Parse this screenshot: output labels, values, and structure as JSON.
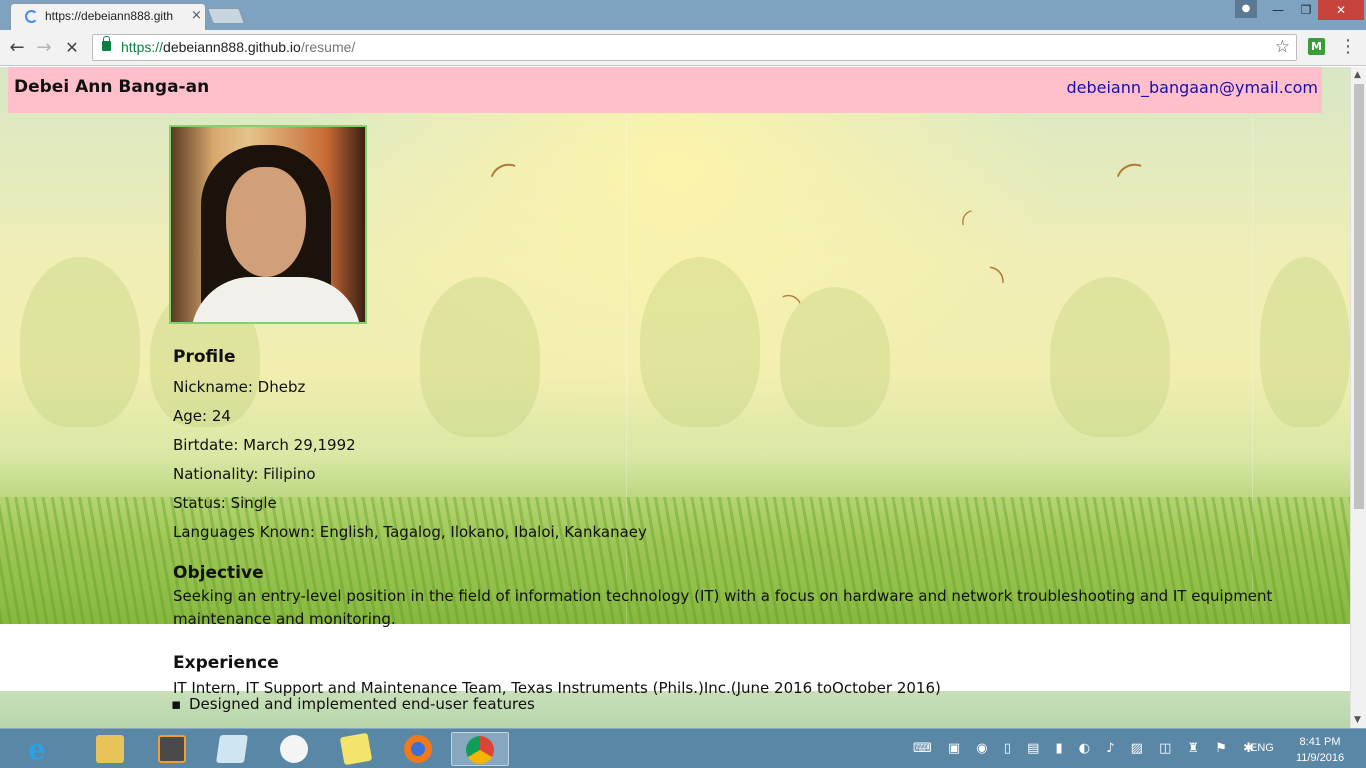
{
  "browser": {
    "tab_title": "https://debeiann888.gith",
    "tab_close": "×",
    "new_tab": "",
    "url_scheme": "https://",
    "url_host": "debeiann888.github.io",
    "url_path": "/resume/",
    "star": "☆",
    "extension": "M",
    "menu": "⋮",
    "window_min": "—",
    "window_max": "❐",
    "window_close": "✕"
  },
  "page": {
    "name": "Debei Ann Banga-an",
    "email": "debeiann_bangaan@ymail.com",
    "profile": {
      "title": "Profile",
      "lines": [
        "Nickname: Dhebz",
        "Age: 24",
        "Birtdate: March 29,1992",
        "Nationality: Filipino",
        "Status: Single",
        "Languages Known: English, Tagalog, Ilokano, Ibaloi, Kankanaey"
      ]
    },
    "objective": {
      "title": "Objective",
      "text": "Seeking an entry-level position in the field of information technology (IT) with a focus on hardware and network troubleshooting and IT equipment maintenance and monitoring."
    },
    "experience": {
      "title": "Experience",
      "job": "IT Intern, IT Support and Maintenance Team, Texas Instruments (Phils.)Inc.(June 2016 toOctober 2016)",
      "first_item": "Designed and implemented end-user features"
    }
  },
  "icons": {
    "back": "←",
    "forward": "→",
    "stop": "✕",
    "bird": "⌒"
  },
  "colors": {
    "header_bg": "#ffc0cb",
    "link": "#1a0dab",
    "photo_border": "#7ed36b",
    "taskbar": "#5b87a7"
  },
  "taskbar": {
    "start": "e",
    "tray": "⌨ ▣ ◉ ▯ ▤ ▮ ◐ ♪ ▨ ◫ ♜ ⚑ ✱",
    "language": "ENG",
    "time": "8:41 PM",
    "date": "11/9/2016"
  }
}
